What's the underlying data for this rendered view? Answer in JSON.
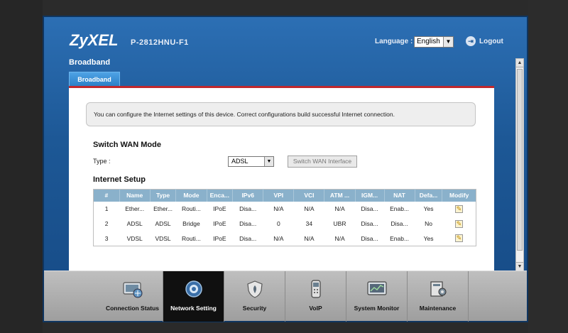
{
  "header": {
    "brand": "ZyXEL",
    "model": "P-2812HNU-F1",
    "language_label": "Language :",
    "language_value": "English",
    "logout_label": "Logout"
  },
  "page": {
    "title": "Broadband",
    "tab": "Broadband",
    "info": "You can configure the Internet settings of this device. Correct configurations build successful Internet connection."
  },
  "wan_mode": {
    "title": "Switch WAN Mode",
    "type_label": "Type :",
    "type_value": "ADSL",
    "switch_button": "Switch WAN Interface"
  },
  "internet_setup": {
    "title": "Internet Setup",
    "columns": [
      "#",
      "Name",
      "Type",
      "Mode",
      "Enca...",
      "IPv6",
      "VPI",
      "VCI",
      "ATM ...",
      "IGM...",
      "NAT",
      "Defa...",
      "Modify"
    ],
    "rows": [
      [
        "1",
        "Ether...",
        "Ether...",
        "Routi...",
        "IPoE",
        "Disa...",
        "N/A",
        "N/A",
        "N/A",
        "Disa...",
        "Enab...",
        "Yes"
      ],
      [
        "2",
        "ADSL",
        "ADSL",
        "Bridge",
        "IPoE",
        "Disa...",
        "0",
        "34",
        "UBR",
        "Disa...",
        "Disa...",
        "No"
      ],
      [
        "3",
        "VDSL",
        "VDSL",
        "Routi...",
        "IPoE",
        "Disa...",
        "N/A",
        "N/A",
        "N/A",
        "Disa...",
        "Enab...",
        "Yes"
      ]
    ]
  },
  "nav": {
    "items": [
      {
        "label": "Connection Status",
        "icon": "connection-status-icon"
      },
      {
        "label": "Network Setting",
        "icon": "network-setting-icon",
        "active": true
      },
      {
        "label": "Security",
        "icon": "security-icon"
      },
      {
        "label": "VoIP",
        "icon": "voip-icon"
      },
      {
        "label": "System Monitor",
        "icon": "system-monitor-icon"
      },
      {
        "label": "Maintenance",
        "icon": "maintenance-icon"
      }
    ]
  },
  "colors": {
    "accent_red": "#c0282d",
    "header_blue": "#1d5896",
    "table_header": "#8ab1cb"
  }
}
